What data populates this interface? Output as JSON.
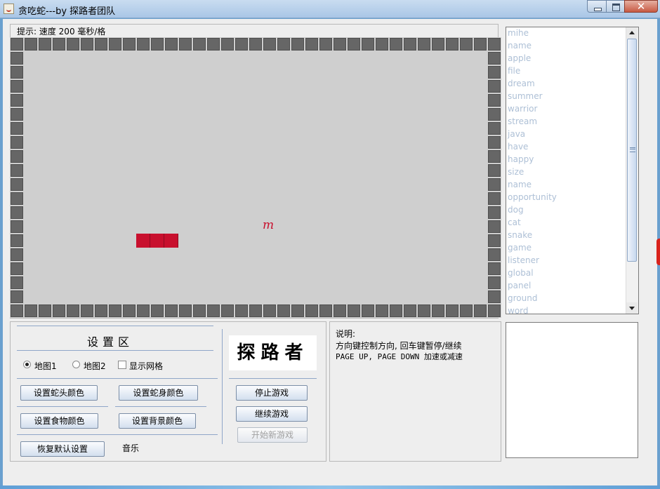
{
  "window": {
    "title": "贪吃蛇---by 探路者团队",
    "controls": {
      "minimize": "",
      "maximize": "",
      "close": "✕"
    }
  },
  "game": {
    "hint": "提示: 速度 200 毫秒/格",
    "food_char": "m",
    "colors": {
      "wall": "#666666",
      "board": "#cfcfcf",
      "snake": "#c8102e",
      "food": "#c8102e"
    }
  },
  "word_list": {
    "items": [
      "mihe",
      "name",
      "apple",
      "file",
      "dream",
      "summer",
      "warrior",
      "stream",
      "java",
      "have",
      "happy",
      "size",
      "name",
      "opportunity",
      "dog",
      "cat",
      "snake",
      "game",
      "listener",
      "global",
      "panel",
      "ground",
      "word"
    ]
  },
  "settings": {
    "title": "设置区",
    "map1_label": "地图1",
    "map2_label": "地图2",
    "show_grid_label": "显示网格",
    "map1_selected": true,
    "map2_selected": false,
    "show_grid_checked": false,
    "snake_head_color_btn": "设置蛇头颜色",
    "snake_body_color_btn": "设置蛇身颜色",
    "food_color_btn": "设置食物颜色",
    "background_color_btn": "设置背景颜色",
    "restore_default_btn": "恢复默认设置",
    "music_label": "音乐"
  },
  "logo": {
    "text": "探路者"
  },
  "controls": {
    "stop_btn": "停止游戏",
    "continue_btn": "继续游戏",
    "new_game_btn": "开始新游戏"
  },
  "instructions": {
    "title": "说明:",
    "line1": "方向键控制方向, 回车键暂停/继续",
    "line2": "PAGE UP, PAGE DOWN 加速或减速"
  }
}
